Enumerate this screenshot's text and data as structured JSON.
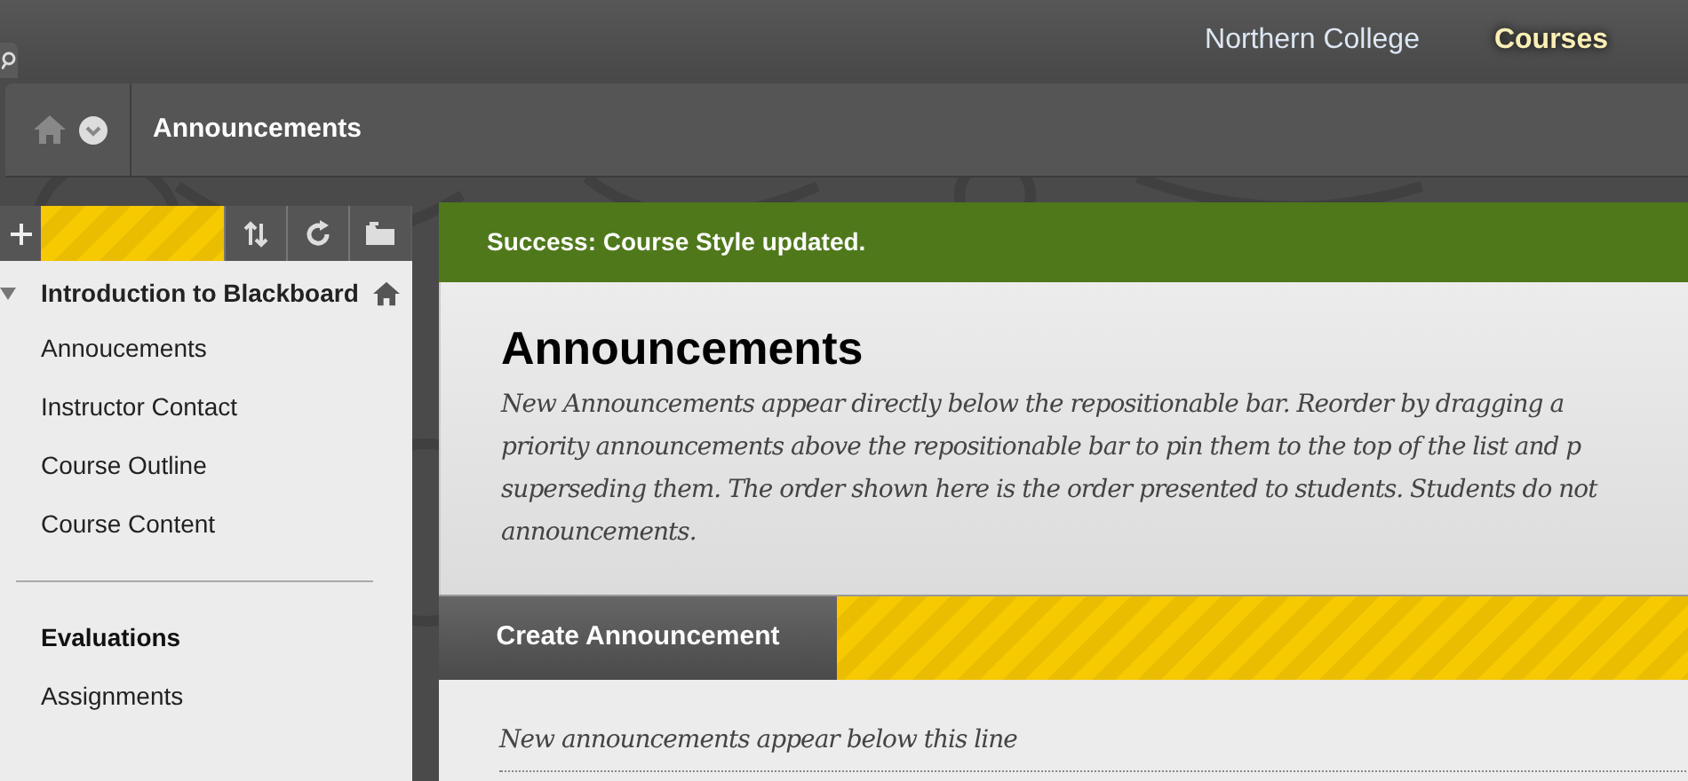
{
  "top_nav": [
    {
      "label": "Northern College",
      "selected": false
    },
    {
      "label": "Courses",
      "selected": true
    }
  ],
  "breadcrumb": {
    "title": "Announcements"
  },
  "sidebar": {
    "course_title": "Introduction to Blackboard",
    "expanded": true,
    "items": [
      {
        "label": "Annoucements",
        "kind": "link"
      },
      {
        "label": "Instructor Contact",
        "kind": "link"
      },
      {
        "label": "Course Outline",
        "kind": "link"
      },
      {
        "label": "Course Content",
        "kind": "link"
      },
      {
        "kind": "divider"
      },
      {
        "label": "Evaluations",
        "kind": "heading"
      },
      {
        "label": "Assignments",
        "kind": "link"
      }
    ]
  },
  "alert": {
    "message": "Success: Course Style updated.",
    "kind": "success"
  },
  "page": {
    "title": "Announcements",
    "description_lines": [
      "New Announcements appear directly below the repositionable bar. Reorder by dragging a",
      "priority announcements above the repositionable bar to pin them to the top of the list and p",
      "superseding them. The order shown here is the order presented to students. Students do not",
      "announcements."
    ]
  },
  "action_bar": {
    "buttons": [
      "Create Announcement"
    ]
  },
  "list_note": "New announcements appear below this line"
}
